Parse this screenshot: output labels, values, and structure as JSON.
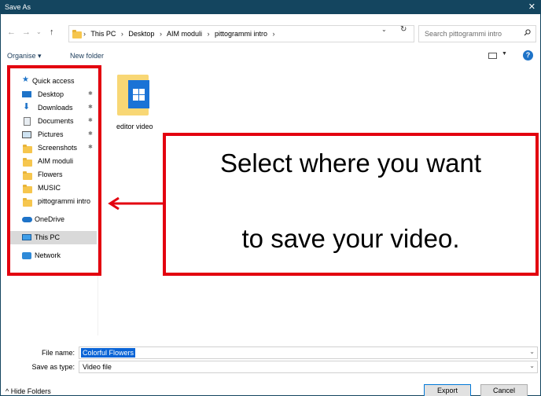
{
  "window": {
    "title": "Save As",
    "close_glyph": "✕"
  },
  "nav_buttons": {
    "back": "←",
    "forward": "→",
    "recent": "⌄",
    "up": "↑"
  },
  "address": {
    "crumbs": [
      "This PC",
      "Desktop",
      "AIM moduli",
      "pittogrammi intro"
    ],
    "separator": "›",
    "dropdown": "⌄",
    "refresh": "↻"
  },
  "search": {
    "placeholder": "Search pittogrammi intro",
    "icon": "search-icon"
  },
  "toolbar": {
    "organise": "Organise ▾",
    "new_folder": "New folder",
    "help": "?"
  },
  "nav_pane": {
    "quick_access": "Quick access",
    "items": [
      {
        "label": "Desktop",
        "icon": "desktop-icon",
        "pinned": true
      },
      {
        "label": "Downloads",
        "icon": "downloads-icon",
        "pinned": true
      },
      {
        "label": "Documents",
        "icon": "documents-icon",
        "pinned": true
      },
      {
        "label": "Pictures",
        "icon": "pictures-icon",
        "pinned": true
      },
      {
        "label": "Screenshots",
        "icon": "folder-icon",
        "pinned": true
      },
      {
        "label": "AIM moduli",
        "icon": "folder-icon",
        "pinned": false
      },
      {
        "label": "Flowers",
        "icon": "folder-icon",
        "pinned": false
      },
      {
        "label": "MUSIC",
        "icon": "folder-icon",
        "pinned": false
      },
      {
        "label": "pittogrammi intro",
        "icon": "folder-icon",
        "pinned": false
      }
    ],
    "onedrive": "OneDrive",
    "this_pc": "This PC",
    "network": "Network",
    "pin_glyph": "✱"
  },
  "files": [
    {
      "name": "editor video",
      "icon": "folder-app-icon"
    }
  ],
  "annotation": {
    "line1": "Select where you want",
    "line2": "to save your video.",
    "color": "#e3000f"
  },
  "fields": {
    "file_name_label": "File name:",
    "file_name_value": "Colorful Flowers",
    "save_as_type_label": "Save as type:",
    "save_as_type_value": "Video file",
    "dropdown": "⌄"
  },
  "footer": {
    "hide_folders": "^  Hide Folders",
    "export": "Export",
    "cancel": "Cancel"
  },
  "colors": {
    "titlebar": "#14455f",
    "accent": "#1e73c8",
    "selection": "#0a64d6"
  }
}
